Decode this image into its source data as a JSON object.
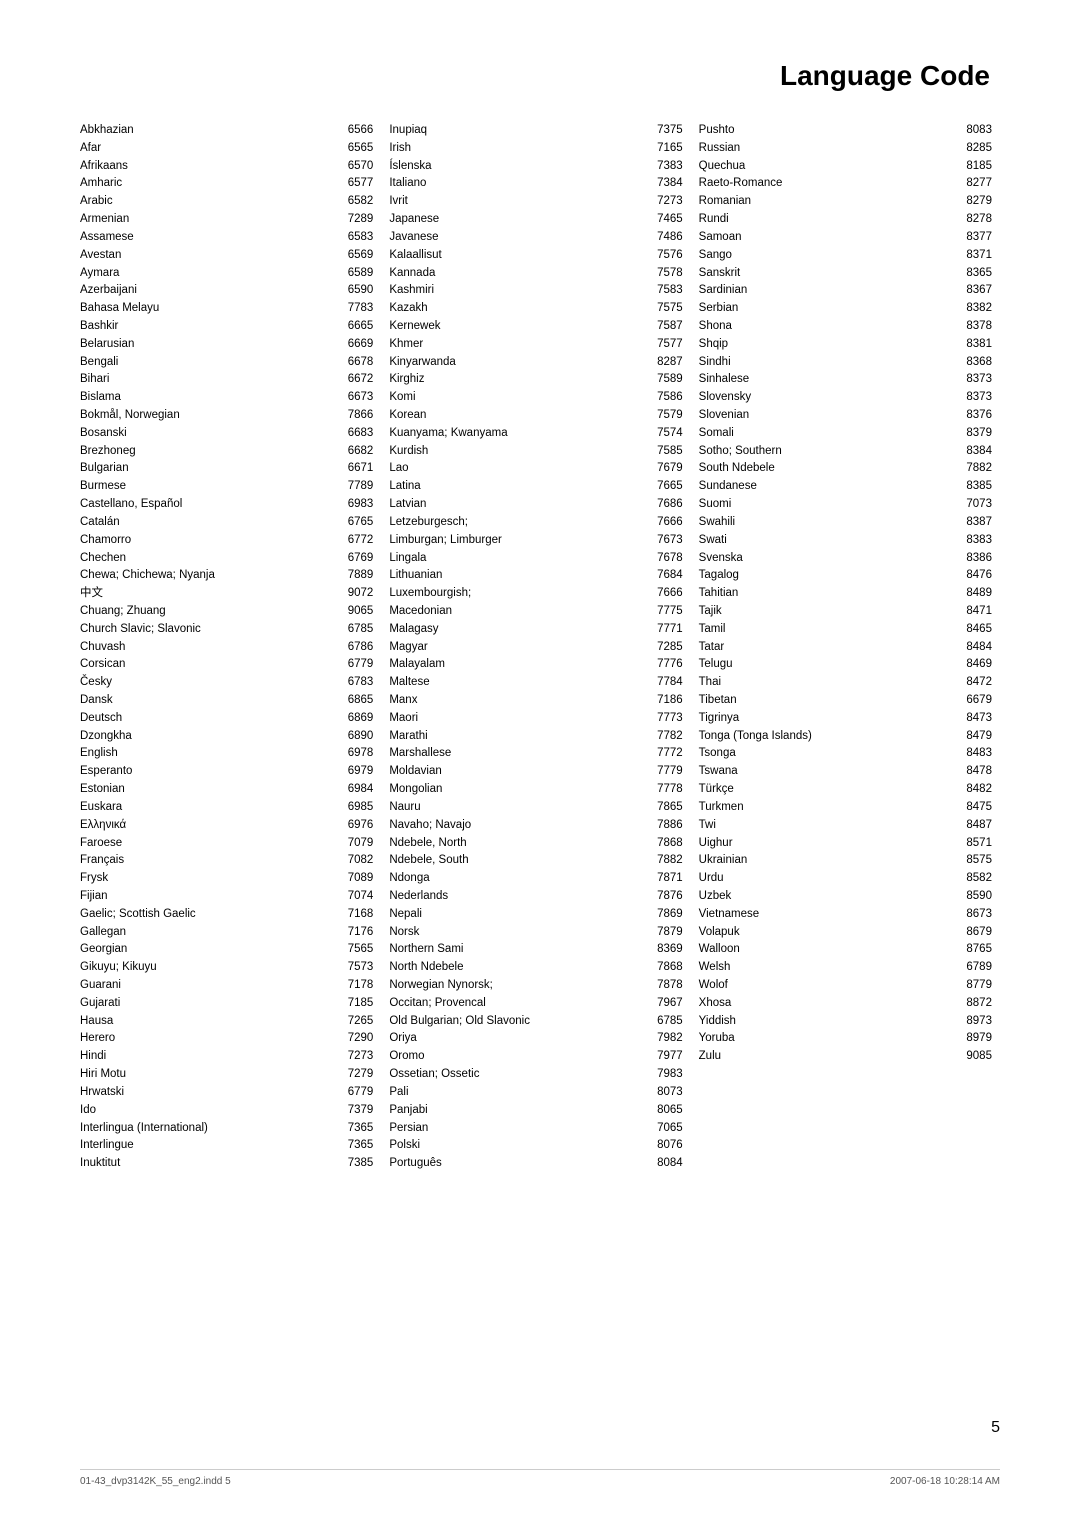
{
  "title": "Language Code",
  "page_number": "5",
  "footer_left": "01-43_dvp3142K_55_eng2.indd   5",
  "footer_right": "2007-06-18   10:28:14 AM",
  "columns": [
    [
      {
        "name": "Abkhazian",
        "code": "6566"
      },
      {
        "name": "Afar",
        "code": "6565"
      },
      {
        "name": "Afrikaans",
        "code": "6570"
      },
      {
        "name": "Amharic",
        "code": "6577"
      },
      {
        "name": "Arabic",
        "code": "6582"
      },
      {
        "name": "Armenian",
        "code": "7289"
      },
      {
        "name": "Assamese",
        "code": "6583"
      },
      {
        "name": "Avestan",
        "code": "6569"
      },
      {
        "name": "Aymara",
        "code": "6589"
      },
      {
        "name": "Azerbaijani",
        "code": "6590"
      },
      {
        "name": "Bahasa Melayu",
        "code": "7783"
      },
      {
        "name": "Bashkir",
        "code": "6665"
      },
      {
        "name": "Belarusian",
        "code": "6669"
      },
      {
        "name": "Bengali",
        "code": "6678"
      },
      {
        "name": "Bihari",
        "code": "6672"
      },
      {
        "name": "Bislama",
        "code": "6673"
      },
      {
        "name": "Bokmål, Norwegian",
        "code": "7866"
      },
      {
        "name": "Bosanski",
        "code": "6683"
      },
      {
        "name": "Brezhoneg",
        "code": "6682"
      },
      {
        "name": "Bulgarian",
        "code": "6671"
      },
      {
        "name": "Burmese",
        "code": "7789"
      },
      {
        "name": "Castellano, Español",
        "code": "6983"
      },
      {
        "name": "Catalán",
        "code": "6765"
      },
      {
        "name": "Chamorro",
        "code": "6772"
      },
      {
        "name": "Chechen",
        "code": "6769"
      },
      {
        "name": "Chewa; Chichewa; Nyanja",
        "code": "7889"
      },
      {
        "name": "中文",
        "code": "9072"
      },
      {
        "name": "Chuang; Zhuang",
        "code": "9065"
      },
      {
        "name": "Church Slavic; Slavonic",
        "code": "6785"
      },
      {
        "name": "Chuvash",
        "code": "6786"
      },
      {
        "name": "Corsican",
        "code": "6779"
      },
      {
        "name": "Česky",
        "code": "6783"
      },
      {
        "name": "Dansk",
        "code": "6865"
      },
      {
        "name": "Deutsch",
        "code": "6869"
      },
      {
        "name": "Dzongkha",
        "code": "6890"
      },
      {
        "name": "English",
        "code": "6978"
      },
      {
        "name": "Esperanto",
        "code": "6979"
      },
      {
        "name": "Estonian",
        "code": "6984"
      },
      {
        "name": "Euskara",
        "code": "6985"
      },
      {
        "name": "Ελληνικά",
        "code": "6976"
      },
      {
        "name": "Faroese",
        "code": "7079"
      },
      {
        "name": "Français",
        "code": "7082"
      },
      {
        "name": "Frysk",
        "code": "7089"
      },
      {
        "name": "Fijian",
        "code": "7074"
      },
      {
        "name": "Gaelic; Scottish Gaelic",
        "code": "7168"
      },
      {
        "name": "Gallegan",
        "code": "7176"
      },
      {
        "name": "Georgian",
        "code": "7565"
      },
      {
        "name": "Gikuyu; Kikuyu",
        "code": "7573"
      },
      {
        "name": "Guarani",
        "code": "7178"
      },
      {
        "name": "Gujarati",
        "code": "7185"
      },
      {
        "name": "Hausa",
        "code": "7265"
      },
      {
        "name": "Herero",
        "code": "7290"
      },
      {
        "name": "Hindi",
        "code": "7273"
      },
      {
        "name": "Hiri Motu",
        "code": "7279"
      },
      {
        "name": "Hrwatski",
        "code": "6779"
      },
      {
        "name": "Ido",
        "code": "7379"
      },
      {
        "name": "Interlingua (International)",
        "code": "7365"
      },
      {
        "name": "Interlingue",
        "code": "7365"
      },
      {
        "name": "Inuktitut",
        "code": "7385"
      }
    ],
    [
      {
        "name": "Inupiaq",
        "code": "7375"
      },
      {
        "name": "Irish",
        "code": "7165"
      },
      {
        "name": "Íslenska",
        "code": "7383"
      },
      {
        "name": "Italiano",
        "code": "7384"
      },
      {
        "name": "Ivrit",
        "code": "7273"
      },
      {
        "name": "Japanese",
        "code": "7465"
      },
      {
        "name": "Javanese",
        "code": "7486"
      },
      {
        "name": "Kalaallisut",
        "code": "7576"
      },
      {
        "name": "Kannada",
        "code": "7578"
      },
      {
        "name": "Kashmiri",
        "code": "7583"
      },
      {
        "name": "Kazakh",
        "code": "7575"
      },
      {
        "name": "Kernewek",
        "code": "7587"
      },
      {
        "name": "Khmer",
        "code": "7577"
      },
      {
        "name": "Kinyarwanda",
        "code": "8287"
      },
      {
        "name": "Kirghiz",
        "code": "7589"
      },
      {
        "name": "Komi",
        "code": "7586"
      },
      {
        "name": "Korean",
        "code": "7579"
      },
      {
        "name": "Kuanyama; Kwanyama",
        "code": "7574"
      },
      {
        "name": "Kurdish",
        "code": "7585"
      },
      {
        "name": "Lao",
        "code": "7679"
      },
      {
        "name": "Latina",
        "code": "7665"
      },
      {
        "name": "Latvian",
        "code": "7686"
      },
      {
        "name": "Letzeburgesch;",
        "code": "7666"
      },
      {
        "name": "Limburgan; Limburger",
        "code": "7673"
      },
      {
        "name": "Lingala",
        "code": "7678"
      },
      {
        "name": "Lithuanian",
        "code": "7684"
      },
      {
        "name": "Luxembourgish;",
        "code": "7666"
      },
      {
        "name": "Macedonian",
        "code": "7775"
      },
      {
        "name": "Malagasy",
        "code": "7771"
      },
      {
        "name": "Magyar",
        "code": "7285"
      },
      {
        "name": "Malayalam",
        "code": "7776"
      },
      {
        "name": "Maltese",
        "code": "7784"
      },
      {
        "name": "Manx",
        "code": "7186"
      },
      {
        "name": "Maori",
        "code": "7773"
      },
      {
        "name": "Marathi",
        "code": "7782"
      },
      {
        "name": "Marshallese",
        "code": "7772"
      },
      {
        "name": "Moldavian",
        "code": "7779"
      },
      {
        "name": "Mongolian",
        "code": "7778"
      },
      {
        "name": "Nauru",
        "code": "7865"
      },
      {
        "name": "Navaho; Navajo",
        "code": "7886"
      },
      {
        "name": "Ndebele, North",
        "code": "7868"
      },
      {
        "name": "Ndebele, South",
        "code": "7882"
      },
      {
        "name": "Ndonga",
        "code": "7871"
      },
      {
        "name": "Nederlands",
        "code": "7876"
      },
      {
        "name": "Nepali",
        "code": "7869"
      },
      {
        "name": "Norsk",
        "code": "7879"
      },
      {
        "name": "Northern Sami",
        "code": "8369"
      },
      {
        "name": "North Ndebele",
        "code": "7868"
      },
      {
        "name": "Norwegian Nynorsk;",
        "code": "7878"
      },
      {
        "name": "Occitan; Provencal",
        "code": "7967"
      },
      {
        "name": "Old Bulgarian; Old Slavonic",
        "code": "6785"
      },
      {
        "name": "Oriya",
        "code": "7982"
      },
      {
        "name": "Oromo",
        "code": "7977"
      },
      {
        "name": "Ossetian; Ossetic",
        "code": "7983"
      },
      {
        "name": "Pali",
        "code": "8073"
      },
      {
        "name": "Panjabi",
        "code": "8065"
      },
      {
        "name": "Persian",
        "code": "7065"
      },
      {
        "name": "Polski",
        "code": "8076"
      },
      {
        "name": "Português",
        "code": "8084"
      }
    ],
    [
      {
        "name": "Pushto",
        "code": "8083"
      },
      {
        "name": "Russian",
        "code": "8285"
      },
      {
        "name": "Quechua",
        "code": "8185"
      },
      {
        "name": "Raeto-Romance",
        "code": "8277"
      },
      {
        "name": "Romanian",
        "code": "8279"
      },
      {
        "name": "Rundi",
        "code": "8278"
      },
      {
        "name": "Samoan",
        "code": "8377"
      },
      {
        "name": "Sango",
        "code": "8371"
      },
      {
        "name": "Sanskrit",
        "code": "8365"
      },
      {
        "name": "Sardinian",
        "code": "8367"
      },
      {
        "name": "Serbian",
        "code": "8382"
      },
      {
        "name": "Shona",
        "code": "8378"
      },
      {
        "name": "Shqip",
        "code": "8381"
      },
      {
        "name": "Sindhi",
        "code": "8368"
      },
      {
        "name": "Sinhalese",
        "code": "8373"
      },
      {
        "name": "Slovensky",
        "code": "8373"
      },
      {
        "name": "Slovenian",
        "code": "8376"
      },
      {
        "name": "Somali",
        "code": "8379"
      },
      {
        "name": "Sotho; Southern",
        "code": "8384"
      },
      {
        "name": "South Ndebele",
        "code": "7882"
      },
      {
        "name": "Sundanese",
        "code": "8385"
      },
      {
        "name": "Suomi",
        "code": "7073"
      },
      {
        "name": "Swahili",
        "code": "8387"
      },
      {
        "name": "Swati",
        "code": "8383"
      },
      {
        "name": "Svenska",
        "code": "8386"
      },
      {
        "name": "Tagalog",
        "code": "8476"
      },
      {
        "name": "Tahitian",
        "code": "8489"
      },
      {
        "name": "Tajik",
        "code": "8471"
      },
      {
        "name": "Tamil",
        "code": "8465"
      },
      {
        "name": "Tatar",
        "code": "8484"
      },
      {
        "name": "Telugu",
        "code": "8469"
      },
      {
        "name": "Thai",
        "code": "8472"
      },
      {
        "name": "Tibetan",
        "code": "6679"
      },
      {
        "name": "Tigrinya",
        "code": "8473"
      },
      {
        "name": "Tonga (Tonga Islands)",
        "code": "8479"
      },
      {
        "name": "Tsonga",
        "code": "8483"
      },
      {
        "name": "Tswana",
        "code": "8478"
      },
      {
        "name": "Türkçe",
        "code": "8482"
      },
      {
        "name": "Turkmen",
        "code": "8475"
      },
      {
        "name": "Twi",
        "code": "8487"
      },
      {
        "name": "Uighur",
        "code": "8571"
      },
      {
        "name": "Ukrainian",
        "code": "8575"
      },
      {
        "name": "Urdu",
        "code": "8582"
      },
      {
        "name": "Uzbek",
        "code": "8590"
      },
      {
        "name": "Vietnamese",
        "code": "8673"
      },
      {
        "name": "Volapuk",
        "code": "8679"
      },
      {
        "name": "Walloon",
        "code": "8765"
      },
      {
        "name": "Welsh",
        "code": "6789"
      },
      {
        "name": "Wolof",
        "code": "8779"
      },
      {
        "name": "Xhosa",
        "code": "8872"
      },
      {
        "name": "Yiddish",
        "code": "8973"
      },
      {
        "name": "Yoruba",
        "code": "8979"
      },
      {
        "name": "Zulu",
        "code": "9085"
      }
    ]
  ]
}
